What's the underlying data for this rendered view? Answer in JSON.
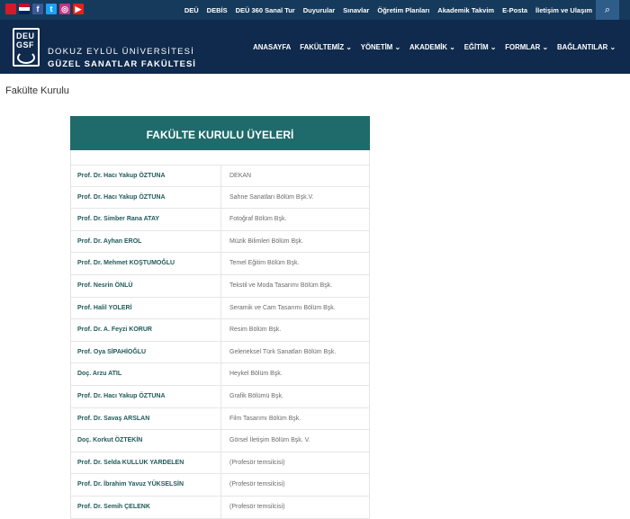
{
  "topbar": {
    "social": [
      "tr-flag-icon",
      "en-flag-icon",
      "facebook-icon",
      "twitter-icon",
      "instagram-icon",
      "youtube-icon"
    ],
    "links": [
      "DEÜ",
      "DEBİS",
      "DEÜ 360 Sanal Tur",
      "Duyurular",
      "Sınavlar",
      "Öğretim Planları",
      "Akademik Takvim",
      "E-Posta",
      "İletişim ve Ulaşım"
    ],
    "search_icon": "search-icon"
  },
  "header": {
    "logo_line1": "DEU",
    "logo_line2": "GSF",
    "university": "DOKUZ EYLÜL ÜNİVERSİTESİ",
    "faculty": "GÜZEL SANATLAR FAKÜLTESİ"
  },
  "nav": [
    "ANASAYFA",
    "FAKÜLTEMİZ ⌄",
    "YÖNETİM ⌄",
    "AKADEMİK ⌄",
    "EĞİTİM ⌄",
    "FORMLAR ⌄",
    "BAĞLANTILAR ⌄"
  ],
  "page": {
    "title": "Fakülte Kurulu"
  },
  "board": {
    "heading": "FAKÜLTE KURULU ÜYELERİ",
    "rows": [
      {
        "name": "Prof. Dr. Hacı Yakup ÖZTUNA",
        "role": "DEKAN"
      },
      {
        "name": "Prof. Dr. Hacı Yakup ÖZTUNA",
        "role": "Sahne Sanatları Bölüm Bşk.V."
      },
      {
        "name": "Prof. Dr. Simber Rana ATAY",
        "role": "Fotoğraf Bölüm Bşk."
      },
      {
        "name": "Prof. Dr. Ayhan EROL",
        "role": "Müzik Bilimleri Bölüm Bşk."
      },
      {
        "name": "Prof. Dr. Mehmet KOŞTUMOĞLU",
        "role": "Temel Eğitim Bölüm Bşk."
      },
      {
        "name": "Prof. Nesrin ÖNLÜ",
        "role": "Tekstil ve Moda Tasarımı Bölüm Bşk."
      },
      {
        "name": "Prof. Halil YOLERİ",
        "role": "Seramik ve Cam Tasarımı Bölüm Bşk."
      },
      {
        "name": "Prof. Dr. A. Feyzi KORUR",
        "role": "Resim Bölüm Bşk."
      },
      {
        "name": "Prof. Oya SİPAHİOĞLU",
        "role": "Geleneksel Türk Sanatları Bölüm Bşk."
      },
      {
        "name": "Doç. Arzu ATIL",
        "role": "Heykel Bölüm Bşk."
      },
      {
        "name": "Prof. Dr. Hacı Yakup ÖZTUNA",
        "role": "Grafik Bölümü Bşk."
      },
      {
        "name": "Prof. Dr. Savaş ARSLAN",
        "role": "Film Tasarımı Bölüm Bşk."
      },
      {
        "name": "Doç. Korkut ÖZTEKİN",
        "role": "Görsel İletişim Bölüm Bşk. V."
      },
      {
        "name": "Prof. Dr. Selda KULLUK YARDELEN",
        "role": "(Profesör temsilcisi)"
      },
      {
        "name": "Prof. Dr. İbrahim Yavuz YÜKSELSİN",
        "role": "(Profesör temsilcisi)"
      },
      {
        "name": "Prof. Dr. Semih ÇELENK",
        "role": "(Profesör temsilcisi)"
      }
    ]
  }
}
